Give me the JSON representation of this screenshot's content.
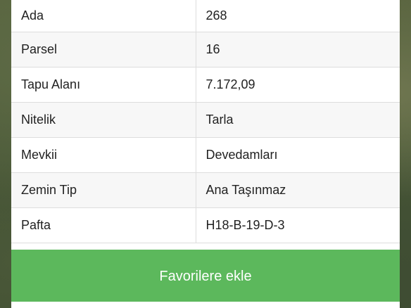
{
  "parcel_table": {
    "rows": [
      {
        "label": "Ada",
        "value": "268"
      },
      {
        "label": "Parsel",
        "value": "16"
      },
      {
        "label": "Tapu Alanı",
        "value": "7.172,09"
      },
      {
        "label": "Nitelik",
        "value": "Tarla"
      },
      {
        "label": "Mevkii",
        "value": "Devedamları"
      },
      {
        "label": "Zemin Tip",
        "value": "Ana Taşınmaz"
      },
      {
        "label": "Pafta",
        "value": "H18-B-19-D-3"
      }
    ]
  },
  "actions": {
    "favorite_label": "Favorilere ekle",
    "button_color": "#5cb85c"
  }
}
